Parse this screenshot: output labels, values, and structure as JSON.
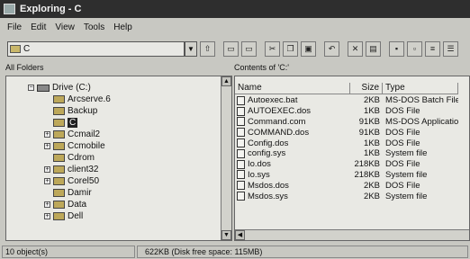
{
  "window": {
    "title": "Exploring - C"
  },
  "menu": [
    "File",
    "Edit",
    "View",
    "Tools",
    "Help"
  ],
  "address": {
    "value": "C"
  },
  "toolbar_icons": [
    "up-folder-icon",
    "map-drive-icon",
    "disconnect-icon",
    "cut-icon",
    "copy-icon",
    "paste-icon",
    "undo-icon",
    "delete-icon",
    "properties-icon",
    "large-icons-icon",
    "small-icons-icon",
    "list-icon",
    "details-icon"
  ],
  "panes": {
    "left_header": "All Folders",
    "right_header": "Contents of 'C:'"
  },
  "tree": [
    {
      "label": "Drive (C:)",
      "level": 0,
      "expander": "minus",
      "drive": true
    },
    {
      "label": "Arcserve.6",
      "level": 1,
      "expander": ""
    },
    {
      "label": "Backup",
      "level": 1,
      "expander": ""
    },
    {
      "label": "C",
      "level": 1,
      "expander": "",
      "selected": true
    },
    {
      "label": "Ccmail2",
      "level": 1,
      "expander": "plus"
    },
    {
      "label": "Ccmobile",
      "level": 1,
      "expander": "plus"
    },
    {
      "label": "Cdrom",
      "level": 1,
      "expander": ""
    },
    {
      "label": "client32",
      "level": 1,
      "expander": "plus"
    },
    {
      "label": "Corel50",
      "level": 1,
      "expander": "plus"
    },
    {
      "label": "Damir",
      "level": 1,
      "expander": ""
    },
    {
      "label": "Data",
      "level": 1,
      "expander": "plus"
    },
    {
      "label": "Dell",
      "level": 1,
      "expander": "plus"
    }
  ],
  "columns": {
    "name": "Name",
    "size": "Size",
    "type": "Type"
  },
  "files": [
    {
      "name": "Autoexec.bat",
      "size": "2KB",
      "type": "MS-DOS Batch File"
    },
    {
      "name": "AUTOEXEC.dos",
      "size": "1KB",
      "type": "DOS File"
    },
    {
      "name": "Command.com",
      "size": "91KB",
      "type": "MS-DOS Application"
    },
    {
      "name": "COMMAND.dos",
      "size": "91KB",
      "type": "DOS File"
    },
    {
      "name": "Config.dos",
      "size": "1KB",
      "type": "DOS File"
    },
    {
      "name": "config.sys",
      "size": "1KB",
      "type": "System file"
    },
    {
      "name": "Io.dos",
      "size": "218KB",
      "type": "DOS File"
    },
    {
      "name": "Io.sys",
      "size": "218KB",
      "type": "System file"
    },
    {
      "name": "Msdos.dos",
      "size": "2KB",
      "type": "DOS File"
    },
    {
      "name": "Msdos.sys",
      "size": "2KB",
      "type": "System file"
    }
  ],
  "status": {
    "left": "10 object(s)",
    "right": "622KB (Disk free space: 115MB)"
  }
}
